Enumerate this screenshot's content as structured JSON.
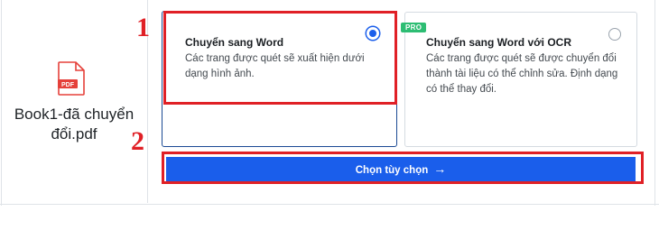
{
  "file": {
    "icon": "pdf-file-icon",
    "icon_label": "PDF",
    "name_line1": "Book1-đã chuyển",
    "name_line2": "đổi.pdf"
  },
  "options": [
    {
      "title": "Chuyển sang Word",
      "desc_lines": [
        "Các trang được quét sẽ xuất hiện dưới",
        "dạng hình ảnh."
      ],
      "selected": true
    },
    {
      "title": "Chuyển sang Word với OCR",
      "badge": "PRO",
      "desc_lines": [
        "Các trang được quét sẽ được chuyển đổi",
        "thành tài liệu có thể chỉnh sửa. Định dạng",
        "có thể thay đổi."
      ],
      "selected": false
    }
  ],
  "cta": {
    "label": "Chọn tùy chọn",
    "arrow": "→"
  },
  "annotations": {
    "step1": "1",
    "step2": "2"
  },
  "colors": {
    "accent": "#1a5eeb",
    "annotation": "#e02026",
    "pro_badge": "#2dbd73",
    "pdf_red": "#e5403a"
  }
}
